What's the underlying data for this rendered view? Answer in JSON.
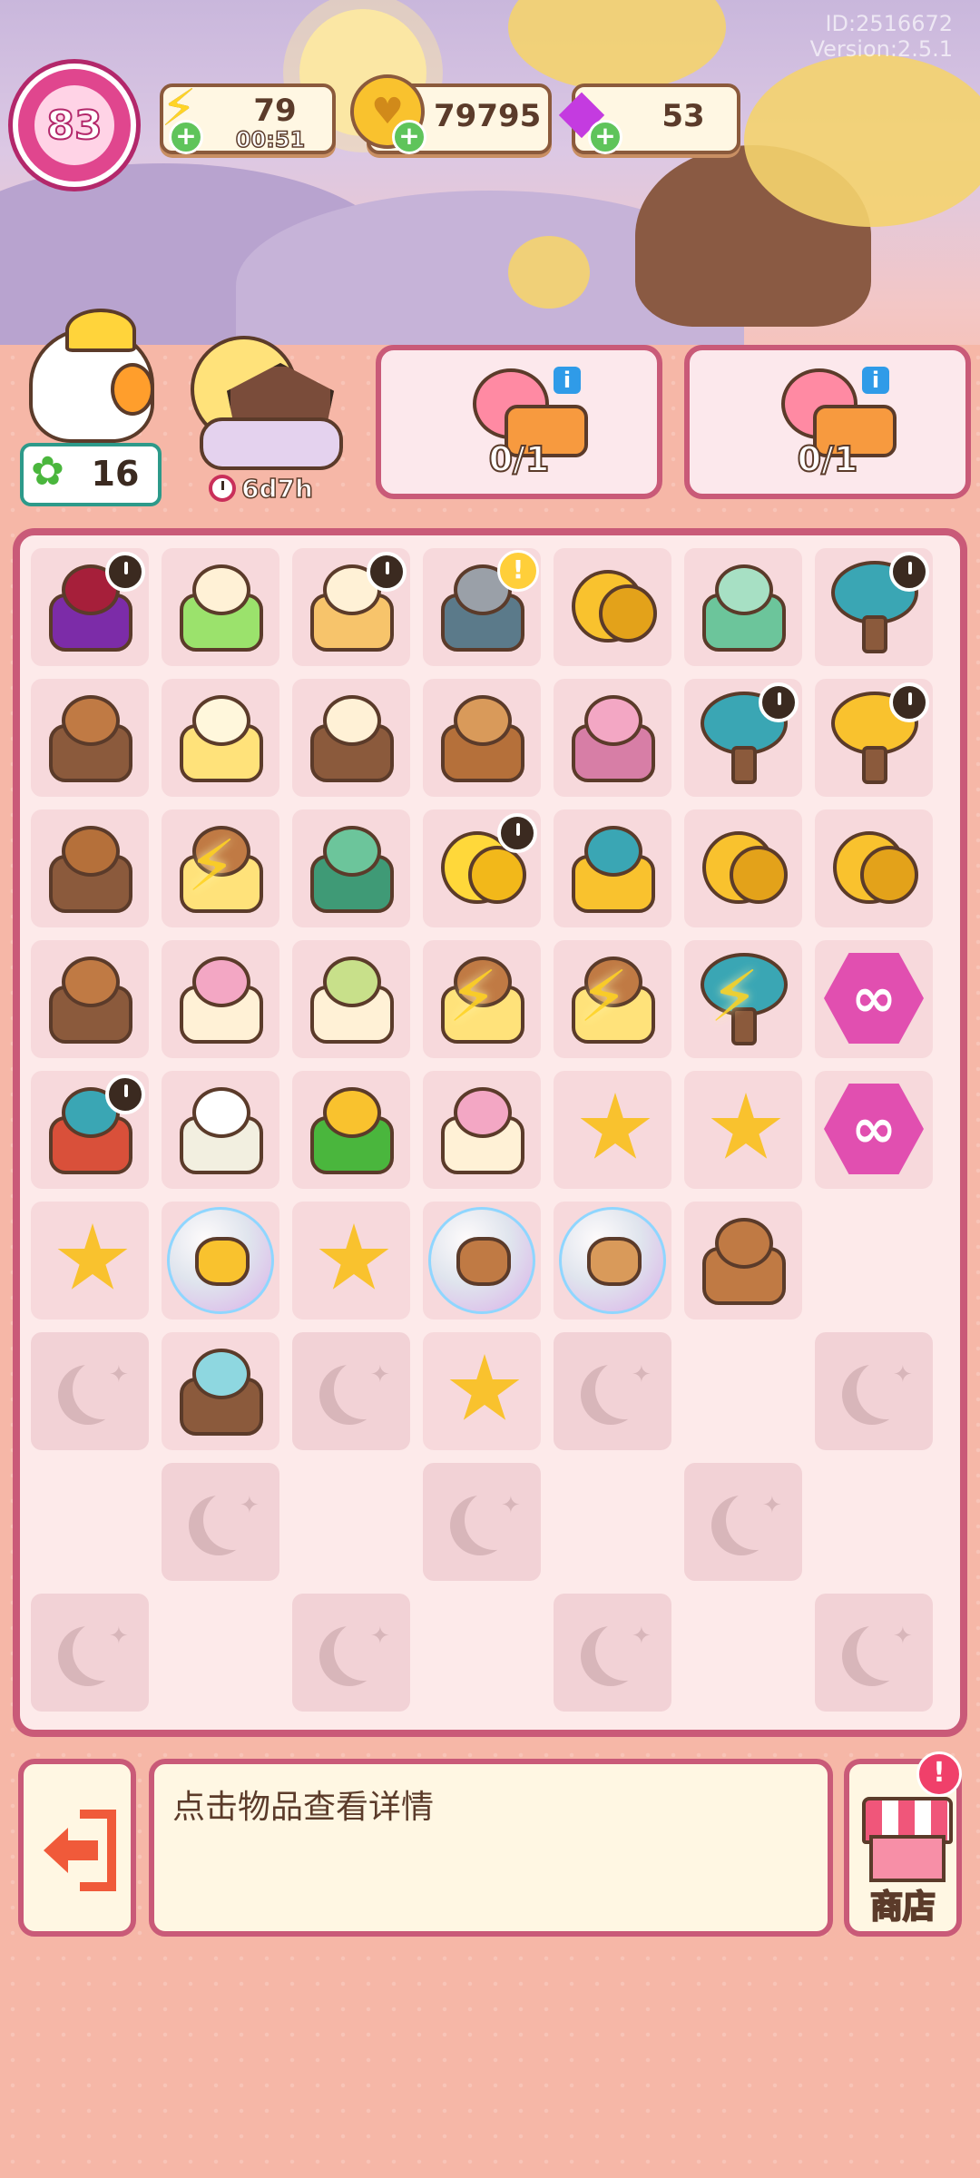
{
  "header": {
    "id_text": "ID:2516672",
    "version_text": "Version:2.5.1"
  },
  "level": {
    "value": "83"
  },
  "resources": {
    "energy": {
      "value": "79",
      "timer": "00:51",
      "icon": "lightning-icon"
    },
    "coins": {
      "value": "79795",
      "icon": "coin-icon"
    },
    "gems": {
      "value": "53",
      "icon": "gem-icon"
    }
  },
  "clover": {
    "value": "16"
  },
  "event": {
    "timer": "6d7h"
  },
  "orders": [
    {
      "count": "0/1",
      "item": "mooncake-plate"
    },
    {
      "count": "0/1",
      "item": "mooncake-plate"
    }
  ],
  "board": {
    "rows": [
      [
        "spider-lily-lantern",
        "bunny-mixing-bowl",
        "bunny-pounding",
        "bunny-mortar",
        "gold-coins",
        "jade-plate",
        "osmanthus-tree"
      ],
      [
        "wooden-ladder",
        "tea-bowl",
        "sake-set",
        "bread-buns",
        "pink-cloth",
        "osmanthus-tree",
        "golden-osmanthus-tree"
      ],
      [
        "wooden-ladle",
        "ladder-energized",
        "jade-bowl",
        "full-moon",
        "osmanthus-leaf",
        "coin-stack",
        "coin-pile"
      ],
      [
        "pig-bread",
        "mooncake-cup",
        "herbal-soup",
        "basket-energized",
        "basket-energized",
        "tree-energized",
        "infinity-gem"
      ],
      [
        "pagoda",
        "white-cloud",
        "osmanthus-branch",
        "mooncake-cup",
        "star-plate",
        "star-crate",
        "infinity-gem"
      ],
      [
        "gold-star",
        "star-bubble",
        "star-basket",
        "pig-bubble",
        "bun-bubble",
        "wooden-twig",
        "empty"
      ],
      [
        "locked",
        "sprout",
        "locked",
        "star-pair",
        "locked",
        "empty",
        "locked"
      ],
      [
        "empty",
        "locked",
        "empty",
        "locked",
        "empty",
        "locked",
        "empty"
      ],
      [
        "locked",
        "empty",
        "locked",
        "empty",
        "locked",
        "empty",
        "locked"
      ]
    ]
  },
  "footer": {
    "info_text": "点击物品查看详情",
    "shop_label": "商店",
    "shop_alert": "!"
  },
  "colors": {
    "frame": "#c95a78",
    "panel": "#fff7e3",
    "background": "#f6b7a7"
  }
}
